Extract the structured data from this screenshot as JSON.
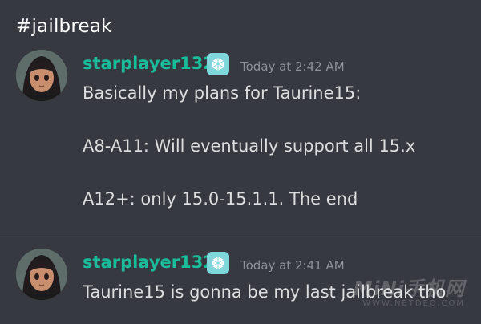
{
  "channel": {
    "title": "#jailbreak"
  },
  "messages": [
    {
      "username": "starplayer132",
      "timestamp": "Today at 2:42 AM",
      "lines": [
        "Basically my plans for Taurine15:",
        "A8-A11: Will eventually support all 15.x",
        "A12+: only 15.0-15.1.1. The end"
      ],
      "badge_icon": "app-badge-icon",
      "avatar_icon": "anime-avatar-icon"
    },
    {
      "username": "starplayer132",
      "timestamp": "Today at 2:41 AM",
      "lines": [
        "Taurine15 is gonna be my last jailbreak tho"
      ],
      "badge_icon": "app-badge-icon",
      "avatar_icon": "anime-avatar-icon"
    }
  ],
  "watermark": {
    "main": "MiNi手机网",
    "sub": "WWW.NETDEO.COM"
  },
  "colors": {
    "background": "#36393f",
    "username": "#1abc9c",
    "message_text": "#dcddde",
    "timestamp": "#8e9297",
    "badge": "#7fd7dc"
  }
}
